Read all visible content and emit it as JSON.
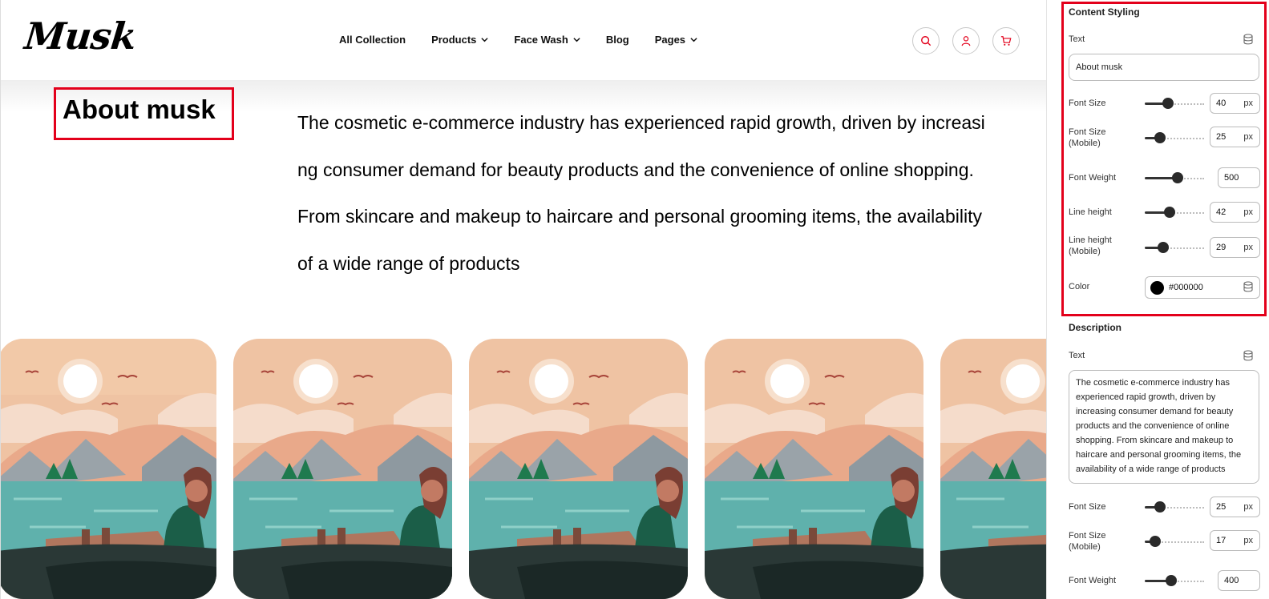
{
  "header": {
    "logo": "Musk",
    "nav": [
      {
        "label": "All Collection",
        "dropdown": false
      },
      {
        "label": "Products",
        "dropdown": true
      },
      {
        "label": "Face Wash",
        "dropdown": true
      },
      {
        "label": "Blog",
        "dropdown": false
      },
      {
        "label": "Pages",
        "dropdown": true
      }
    ],
    "icons": [
      "search-icon",
      "user-icon",
      "cart-icon"
    ],
    "accent": "#e3001b"
  },
  "about": {
    "title": "About musk",
    "description": "The cosmetic e-commerce industry has experienced rapid growth, driven by increasing consumer demand for beauty products and the convenience of online shopping. From skincare and makeup to haircare and personal grooming items, the availability of a wide range of products"
  },
  "gallery": {
    "image_icon": "landscape-illustration-woman-in-boat"
  },
  "panel": {
    "content_styling": {
      "title": "Content Styling",
      "text_label": "Text",
      "text_value": "About musk",
      "font_size_label": "Font Size",
      "font_size": "40",
      "font_size_mobile_label_1": "Font Size",
      "font_size_mobile_label_2": "(Mobile)",
      "font_size_mobile": "25",
      "font_weight_label": "Font Weight",
      "font_weight": "500",
      "line_height_label": "Line height",
      "line_height": "42",
      "line_height_mobile_label_1": "Line height",
      "line_height_mobile_label_2": "(Mobile)",
      "line_height_mobile": "29",
      "color_label": "Color",
      "color": "#000000",
      "unit": "px"
    },
    "description": {
      "title": "Description",
      "text_label": "Text",
      "text_value": "The cosmetic e-commerce industry has experienced rapid growth, driven by increasing consumer demand for beauty products and the convenience of online shopping. From skincare and makeup to haircare and personal grooming items, the availability of a wide range of products",
      "font_size_label": "Font Size",
      "font_size": "25",
      "font_size_mobile_label_1": "Font Size",
      "font_size_mobile_label_2": "(Mobile)",
      "font_size_mobile": "17",
      "font_weight_label": "Font Weight",
      "font_weight": "400",
      "unit": "px"
    }
  }
}
